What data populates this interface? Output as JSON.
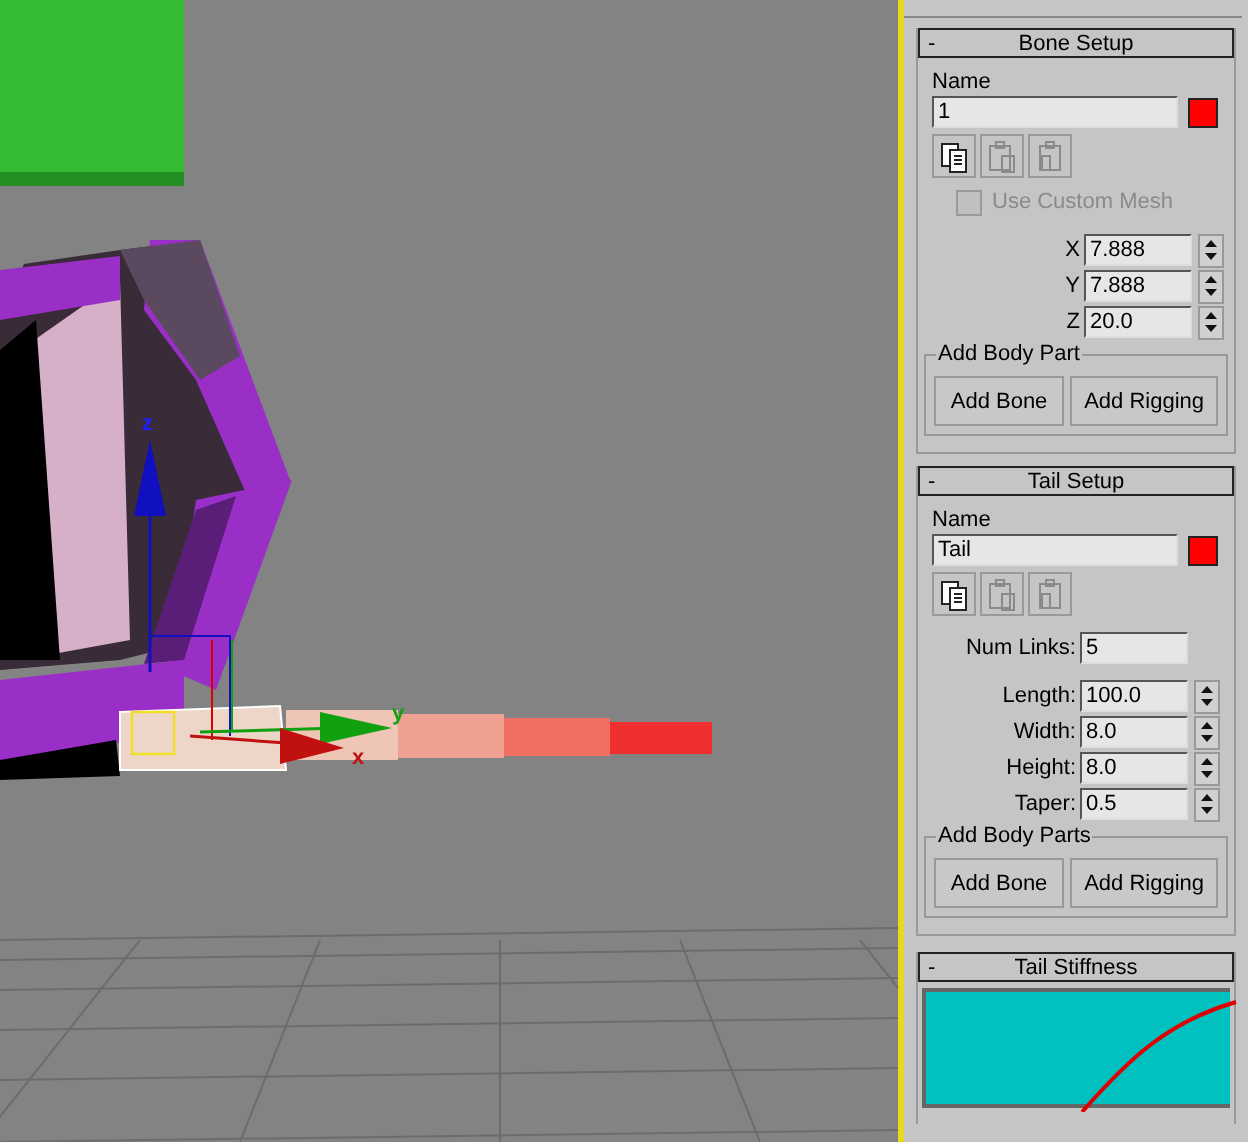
{
  "viewport": {
    "axis_labels": [
      {
        "text": "z"
      },
      {
        "text": "y"
      },
      {
        "text": "x"
      }
    ]
  },
  "bone_setup": {
    "collapse": "-",
    "title": "Bone Setup",
    "name_label": "Name",
    "name_value": "1",
    "color": "#ff0000",
    "copy_buttons": [
      {
        "kind": "copy",
        "disabled": false
      },
      {
        "kind": "paste",
        "disabled": true
      },
      {
        "kind": "paste-instance",
        "disabled": true
      }
    ],
    "use_custom_mesh": {
      "label": "Use Custom Mesh",
      "checked": false,
      "disabled": true
    },
    "fields": [
      {
        "label": "X",
        "value": "7.888"
      },
      {
        "label": "Y",
        "value": "7.888"
      },
      {
        "label": "Z",
        "value": "20.0"
      }
    ],
    "group_title": "Add Body Part",
    "buttons": [
      "Add Bone",
      "Add Rigging"
    ]
  },
  "tail_setup": {
    "collapse": "-",
    "title": "Tail Setup",
    "name_label": "Name",
    "name_value": "Tail",
    "color": "#ff0000",
    "copy_buttons": [
      {
        "kind": "copy",
        "disabled": false
      },
      {
        "kind": "paste",
        "disabled": true
      },
      {
        "kind": "paste-instance",
        "disabled": true
      }
    ],
    "num_links": {
      "label": "Num Links:",
      "value": "5"
    },
    "fields": [
      {
        "label": "Length:",
        "value": "100.0"
      },
      {
        "label": "Width:",
        "value": "8.0"
      },
      {
        "label": "Height:",
        "value": "8.0"
      },
      {
        "label": "Taper:",
        "value": "0.5"
      }
    ],
    "group_title": "Add Body Parts",
    "buttons": [
      "Add Bone",
      "Add Rigging"
    ]
  },
  "tail_stiffness": {
    "collapse": "-",
    "title": "Tail Stiffness"
  }
}
